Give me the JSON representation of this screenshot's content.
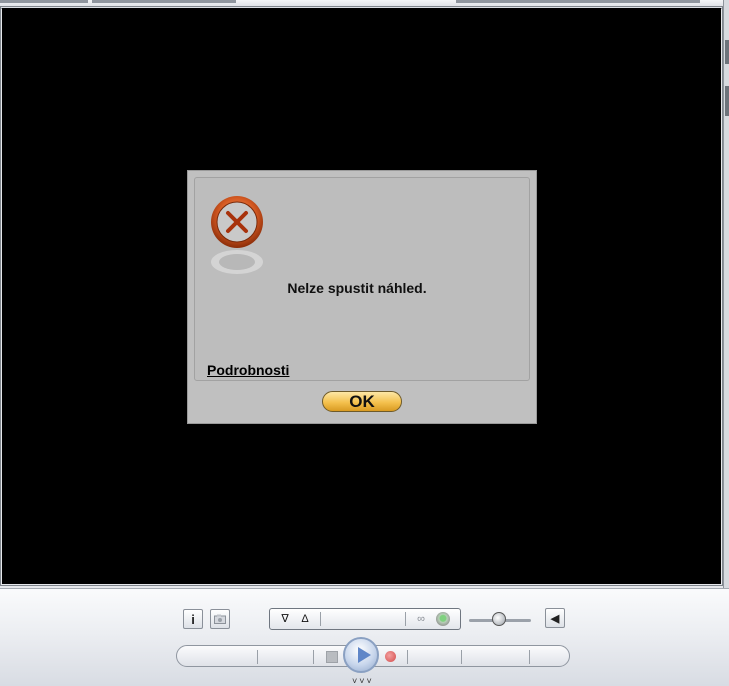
{
  "dialog": {
    "message": "Nelze spustit náhled.",
    "details_link": "Podrobnosti",
    "ok_label": "OK",
    "icon": "error-x-icon",
    "accent_color": "#c4501f"
  },
  "controls": {
    "info_icon_glyph": "i",
    "snapshot_icon": "camera-icon",
    "mark_in_glyph": "∇",
    "mark_out_glyph": "Δ",
    "loop_icon": "loop-icon",
    "status_led_color": "#5cc05c",
    "volume_level": 0.45,
    "mute_icon_glyph": "◀",
    "play_icon": "play-icon",
    "stop_icon": "stop-icon",
    "record_icon": "record-icon",
    "grip_glyph": "˅˅˅"
  }
}
